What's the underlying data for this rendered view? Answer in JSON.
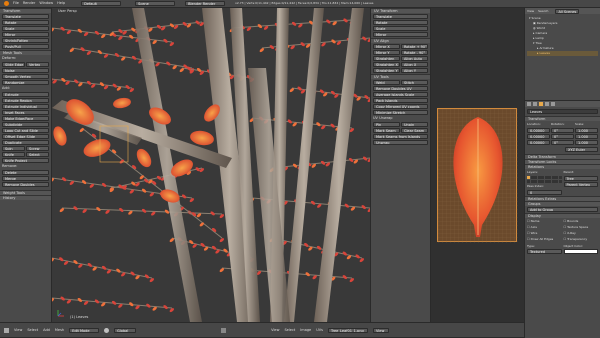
{
  "topbar": {
    "menus": [
      "File",
      "Render",
      "Window",
      "Help"
    ],
    "layout": "Default",
    "scene": "Scene",
    "engine": "Blender Render",
    "stats": "v2.73 | Verts:0/11,442 | Edges:0/11,442 | Faces:0/2,834 | Tris:11,834 | Mem:14,060 | Leaves"
  },
  "toolshelf": {
    "translate": "Translate",
    "rotate": "Rotate",
    "scale": "Scale",
    "mirror": "Mirror",
    "shrink": "Shrink/Fatten",
    "push": "Push/Pull",
    "mesh_tools": "Mesh Tools",
    "deform": "Deform:",
    "slide_edge": "Slide Edge",
    "vertex": "Vertex",
    "noise": "Noise",
    "smooth": "Smooth Vertex",
    "randomize": "Randomize",
    "add": "Add:",
    "extrude": "Extrude",
    "extrude_region": "Extrude Region",
    "extrude_individual": "Extrude Individual",
    "inset": "Inset Faces",
    "make_edge": "Make Edge/Face",
    "subdivide": "Subdivide",
    "loop_cut": "Loop Cut and Slide",
    "offset": "Offset Edge Slide",
    "duplicate": "Duplicate",
    "spin": "Spin",
    "screw": "Screw",
    "knife": "Knife",
    "select": "Select",
    "knife_project": "Knife Project",
    "remove": "Remove:",
    "delete": "Delete",
    "merge": "Merge",
    "remove_doubles": "Remove Doubles",
    "weight_tools": "Weight Tools",
    "history": "History",
    "cursor": "Set 3D Cursor"
  },
  "viewport": {
    "label": "User Persp",
    "footer_label": "(1) Leaves",
    "header": [
      "View",
      "Select",
      "Add",
      "Mesh"
    ],
    "mode": "Edit Mode",
    "global": "Global"
  },
  "uvtools": {
    "transform": "UV Transform",
    "translate": "Translate",
    "rotate": "Rotate",
    "scale": "Scale",
    "mirror": "Mirror",
    "uv_align": "UV Align",
    "mirror_x": "Mirror X",
    "mirror_y": "Mirror Y",
    "rotate_90": "Rotate + 90°",
    "rotate_m90": "Rotate - 90°",
    "straighten": "Straighten",
    "straighten_x": "Straighten X",
    "straighten_y": "Straighten Y",
    "align_auto": "Align Auto",
    "align_x": "Align X",
    "align_y": "Align Y",
    "uv_tools": "UV Tools",
    "weld": "Weld",
    "stitch": "Stitch",
    "remove_doubles_uv": "Remove Doubles UV",
    "average_islands": "Average Islands Scale",
    "pack_islands": "Pack Islands",
    "copy_mirrored": "Copy Mirrored UV coords",
    "minimize_stretch": "Minimize Stretch",
    "uv_unwrap": "UV Unwrap",
    "pin": "Pin",
    "unpin": "Unpin",
    "mark_seam": "Mark Seam",
    "clear_seam": "Clear Seam",
    "mark_seams_islands": "Mark Seams from Islands",
    "unwrap": "Unwrap"
  },
  "uvheader": {
    "items": [
      "View",
      "Image",
      "UVs"
    ],
    "image": "Tree_Leaf01_1.png",
    "mode": "View"
  },
  "outliner": {
    "tabs": [
      "View",
      "Search",
      "All Scenes"
    ],
    "items": [
      "Scene",
      "RenderLayers",
      "World",
      "Camera",
      "Lamp",
      "Tree",
      "Armature",
      "Leaves"
    ]
  },
  "properties": {
    "object": "Leaves",
    "transform": "Transform",
    "location": "Location:",
    "rotation": "Rotation:",
    "scale": "Scale:",
    "loc": [
      "0.00000",
      "0.00000",
      "0.00000"
    ],
    "rot": [
      "0°",
      "0°",
      "0°"
    ],
    "scl": [
      "1.000",
      "1.000",
      "1.000"
    ],
    "mode": "XYZ Euler",
    "delta": "Delta Transform",
    "locks": "Transform Locks",
    "relations": "Relations",
    "layers": "Layers:",
    "parent": "Parent:",
    "parent_val": "Tree",
    "parent_type": "Parent Vertex",
    "pass_index": "Pass Index:",
    "pass_index_val": "0",
    "relations_extras": "Relations Extras",
    "groups": "Groups",
    "add_group": "Add to Group",
    "display": "Display",
    "name": "Name",
    "axis": "Axis",
    "wire": "Wire",
    "draw_all_edges": "Draw All Edges",
    "bounds": "Bounds",
    "texture_space": "Texture Space",
    "xray": "X-Ray",
    "transparency": "Transparency",
    "type": "Type:",
    "type_val": "Textured",
    "color": "Object Color:"
  },
  "bottom": {
    "uv_items": [
      "View",
      "Select",
      "Image",
      "UVs"
    ]
  }
}
